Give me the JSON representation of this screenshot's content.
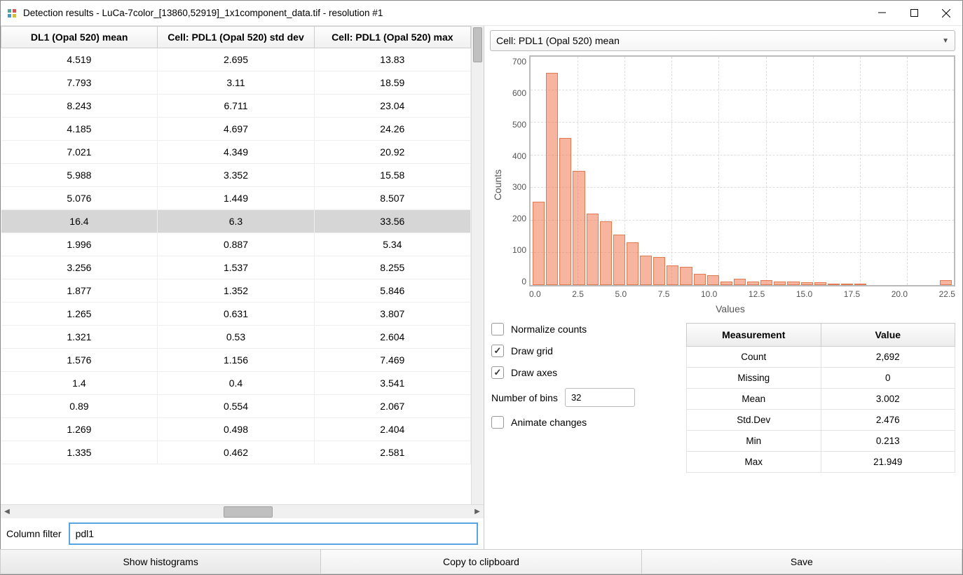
{
  "window_title": "Detection results - LuCa-7color_[13860,52919]_1x1component_data.tif - resolution #1",
  "table": {
    "headers": [
      "DL1 (Opal 520) mean",
      "Cell: PDL1 (Opal 520) std dev",
      "Cell: PDL1 (Opal 520) max"
    ],
    "rows": [
      [
        "4.519",
        "2.695",
        "13.83"
      ],
      [
        "7.793",
        "3.11",
        "18.59"
      ],
      [
        "8.243",
        "6.711",
        "23.04"
      ],
      [
        "4.185",
        "4.697",
        "24.26"
      ],
      [
        "7.021",
        "4.349",
        "20.92"
      ],
      [
        "5.988",
        "3.352",
        "15.58"
      ],
      [
        "5.076",
        "1.449",
        "8.507"
      ],
      [
        "16.4",
        "6.3",
        "33.56"
      ],
      [
        "1.996",
        "0.887",
        "5.34"
      ],
      [
        "3.256",
        "1.537",
        "8.255"
      ],
      [
        "1.877",
        "1.352",
        "5.846"
      ],
      [
        "1.265",
        "0.631",
        "3.807"
      ],
      [
        "1.321",
        "0.53",
        "2.604"
      ],
      [
        "1.576",
        "1.156",
        "7.469"
      ],
      [
        "1.4",
        "0.4",
        "3.541"
      ],
      [
        "0.89",
        "0.554",
        "2.067"
      ],
      [
        "1.269",
        "0.498",
        "2.404"
      ],
      [
        "1.335",
        "0.462",
        "2.581"
      ]
    ],
    "selected_index": 7
  },
  "filter": {
    "label": "Column filter",
    "value": "pdl1"
  },
  "combo_selected": "Cell: PDL1 (Opal 520) mean",
  "chart_data": {
    "type": "bar",
    "title": "",
    "xlabel": "Values",
    "ylabel": "Counts",
    "xlim": [
      0,
      22.5
    ],
    "ylim": [
      0,
      700
    ],
    "xticks": [
      "0.0",
      "2.5",
      "5.0",
      "7.5",
      "10.0",
      "12.5",
      "15.0",
      "17.5",
      "20.0",
      "22.5"
    ],
    "yticks": [
      "700",
      "600",
      "500",
      "400",
      "300",
      "200",
      "100",
      "0"
    ],
    "values": [
      255,
      650,
      452,
      350,
      220,
      195,
      155,
      130,
      90,
      85,
      60,
      55,
      35,
      30,
      10,
      20,
      10,
      15,
      10,
      10,
      8,
      8,
      5,
      5,
      5,
      0,
      0,
      0,
      0,
      0,
      0,
      15
    ]
  },
  "controls": {
    "normalize_label": "Normalize counts",
    "normalize_checked": false,
    "grid_label": "Draw grid",
    "grid_checked": true,
    "axes_label": "Draw axes",
    "axes_checked": true,
    "bins_label": "Number of bins",
    "bins_value": "32",
    "animate_label": "Animate changes",
    "animate_checked": false
  },
  "stats": {
    "headers": [
      "Measurement",
      "Value"
    ],
    "rows": [
      [
        "Count",
        "2,692"
      ],
      [
        "Missing",
        "0"
      ],
      [
        "Mean",
        "3.002"
      ],
      [
        "Std.Dev",
        "2.476"
      ],
      [
        "Min",
        "0.213"
      ],
      [
        "Max",
        "21.949"
      ]
    ]
  },
  "buttons": {
    "histograms": "Show histograms",
    "copy": "Copy to clipboard",
    "save": "Save"
  }
}
